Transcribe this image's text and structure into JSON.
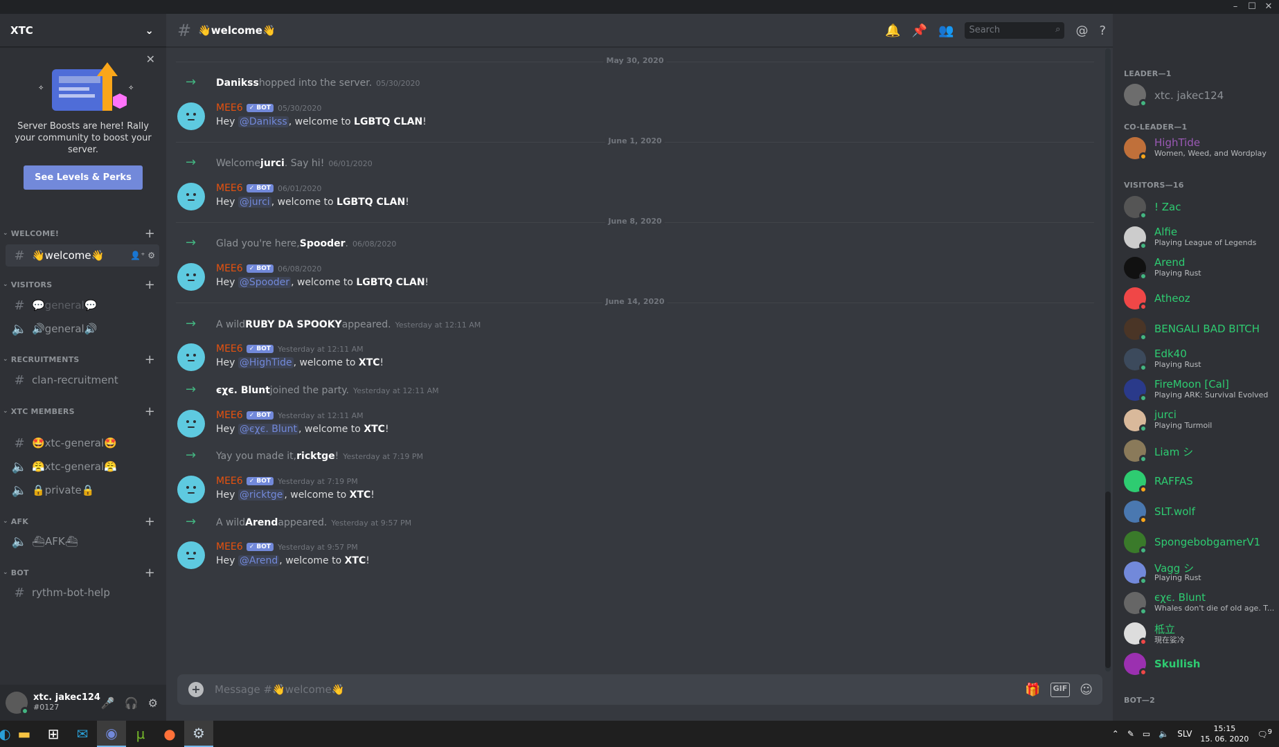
{
  "colors": {
    "blurple": "#7289da",
    "green": "#2ecc71",
    "mee6": "#e8520e",
    "online": "#43b581"
  },
  "server": {
    "name": "XTC"
  },
  "boost": {
    "text": "Server Boosts are here! Rally your community to boost your server.",
    "button": "See Levels & Perks"
  },
  "categories": {
    "welcome": "WELCOME!",
    "visitors": "VISITORS",
    "recruitments": "RECRUITMENTS",
    "xtc_members": "XTC MEMBERS",
    "afk": "AFK",
    "bot": "BOT"
  },
  "channels": {
    "welcome": "👋welcome👋",
    "general_text": "💬general💬",
    "general_voice": "🔊general🔊",
    "clan_recruitment": "clan-recruitment",
    "xtc_general_text": "🤩xtc-general🤩",
    "xtc_general_voice": "😤xtc-general😤",
    "private": "🔒private🔒",
    "afk": "⛴AFK⛴",
    "rythm": "rythm-bot-help"
  },
  "user": {
    "name": "xtc. jakec124",
    "discriminator": "#0127"
  },
  "chat": {
    "title": "👋welcome👋",
    "search_placeholder": "Search",
    "input_placeholder": "Message #👋welcome👋"
  },
  "dividers": [
    "May 30, 2020",
    "June 1, 2020",
    "June 8, 2020",
    "June 14, 2020"
  ],
  "system_messages": [
    {
      "pre": "",
      "name": "Danikss",
      "post": " hopped into the server.",
      "ts": "05/30/2020"
    },
    {
      "pre": "Welcome ",
      "name": "jurci",
      "post": ". Say hi!",
      "ts": "06/01/2020"
    },
    {
      "pre": "Glad you're here, ",
      "name": "Spooder",
      "post": ".",
      "ts": "06/08/2020"
    },
    {
      "pre": "A wild ",
      "name": "RUBY DA SPOOKY",
      "post": " appeared.",
      "ts": "Yesterday at 12:11 AM"
    },
    {
      "pre": "",
      "name": "єχє. Blunt",
      "post": " joined the party.",
      "ts": "Yesterday at 12:11 AM"
    },
    {
      "pre": "Yay you made it, ",
      "name": "ricktge",
      "post": "!",
      "ts": "Yesterday at 7:19 PM"
    },
    {
      "pre": "A wild ",
      "name": "Arend",
      "post": " appeared.",
      "ts": "Yesterday at 9:57 PM"
    }
  ],
  "bot_messages": [
    {
      "author": "MEE6",
      "badge": "✓ BOT",
      "ts": "05/30/2020",
      "pre": "Hey ",
      "mention": "@Danikss",
      "mid": ", welcome to ",
      "server": "LGBTQ CLAN",
      "post": "!"
    },
    {
      "author": "MEE6",
      "badge": "✓ BOT",
      "ts": "06/01/2020",
      "pre": "Hey ",
      "mention": "@jurci",
      "mid": ", welcome to ",
      "server": "LGBTQ CLAN",
      "post": "!"
    },
    {
      "author": "MEE6",
      "badge": "✓ BOT",
      "ts": "06/08/2020",
      "pre": "Hey ",
      "mention": "@Spooder",
      "mid": ", welcome to ",
      "server": "LGBTQ CLAN",
      "post": "!"
    },
    {
      "author": "MEE6",
      "badge": "✓ BOT",
      "ts": "Yesterday at 12:11 AM",
      "pre": "Hey ",
      "mention": "@HighTide",
      "mid": ", welcome to ",
      "server": "XTC",
      "post": "!"
    },
    {
      "author": "MEE6",
      "badge": "✓ BOT",
      "ts": "Yesterday at 12:11 AM",
      "pre": "Hey ",
      "mention": "@єχє. Blunt",
      "mid": ", welcome to ",
      "server": "XTC",
      "post": "!"
    },
    {
      "author": "MEE6",
      "badge": "✓ BOT",
      "ts": "Yesterday at 7:19 PM",
      "pre": "Hey ",
      "mention": "@ricktge",
      "mid": ", welcome to ",
      "server": "XTC",
      "post": "!"
    },
    {
      "author": "MEE6",
      "badge": "✓ BOT",
      "ts": "Yesterday at 9:57 PM",
      "pre": "Hey ",
      "mention": "@Arend",
      "mid": ", welcome to ",
      "server": "XTC",
      "post": "!"
    }
  ],
  "member_groups": {
    "leader": "LEADER—1",
    "coleader": "CO-LEADER—1",
    "visitors": "VISITORS—16",
    "bot": "BOT—2"
  },
  "members": [
    {
      "name": "xtc. jakec124",
      "activity": ""
    },
    {
      "name": "HighTide",
      "activity": "Women, Weed, and Wordplay"
    },
    {
      "name": "! Zac",
      "activity": ""
    },
    {
      "name": "Alfie",
      "activity": "Playing League of Legends"
    },
    {
      "name": "Arend",
      "activity": "Playing Rust"
    },
    {
      "name": "Atheoz",
      "activity": ""
    },
    {
      "name": "BENGALI BAD BITCH",
      "activity": ""
    },
    {
      "name": "Edk40",
      "activity": "Playing Rust"
    },
    {
      "name": "FireMoon [Cal]",
      "activity": "Playing ARK: Survival Evolved"
    },
    {
      "name": "jurci",
      "activity": "Playing Turmoil"
    },
    {
      "name": "Liam シ",
      "activity": ""
    },
    {
      "name": "RAFFAS",
      "activity": ""
    },
    {
      "name": "SLT.wolf",
      "activity": ""
    },
    {
      "name": "SpongebobgamerV1",
      "activity": ""
    },
    {
      "name": "Vagg シ",
      "activity": "Playing Rust"
    },
    {
      "name": "єχє. Blunt",
      "activity": "Whales don't die of old age. T..."
    },
    {
      "name": "柢立",
      "activity": "現在娑冷"
    },
    {
      "name": "Skullish",
      "activity": ""
    }
  ],
  "taskbar": {
    "lang": "SLV",
    "time": "15:15",
    "date": "15. 06. 2020",
    "notif": "9"
  }
}
